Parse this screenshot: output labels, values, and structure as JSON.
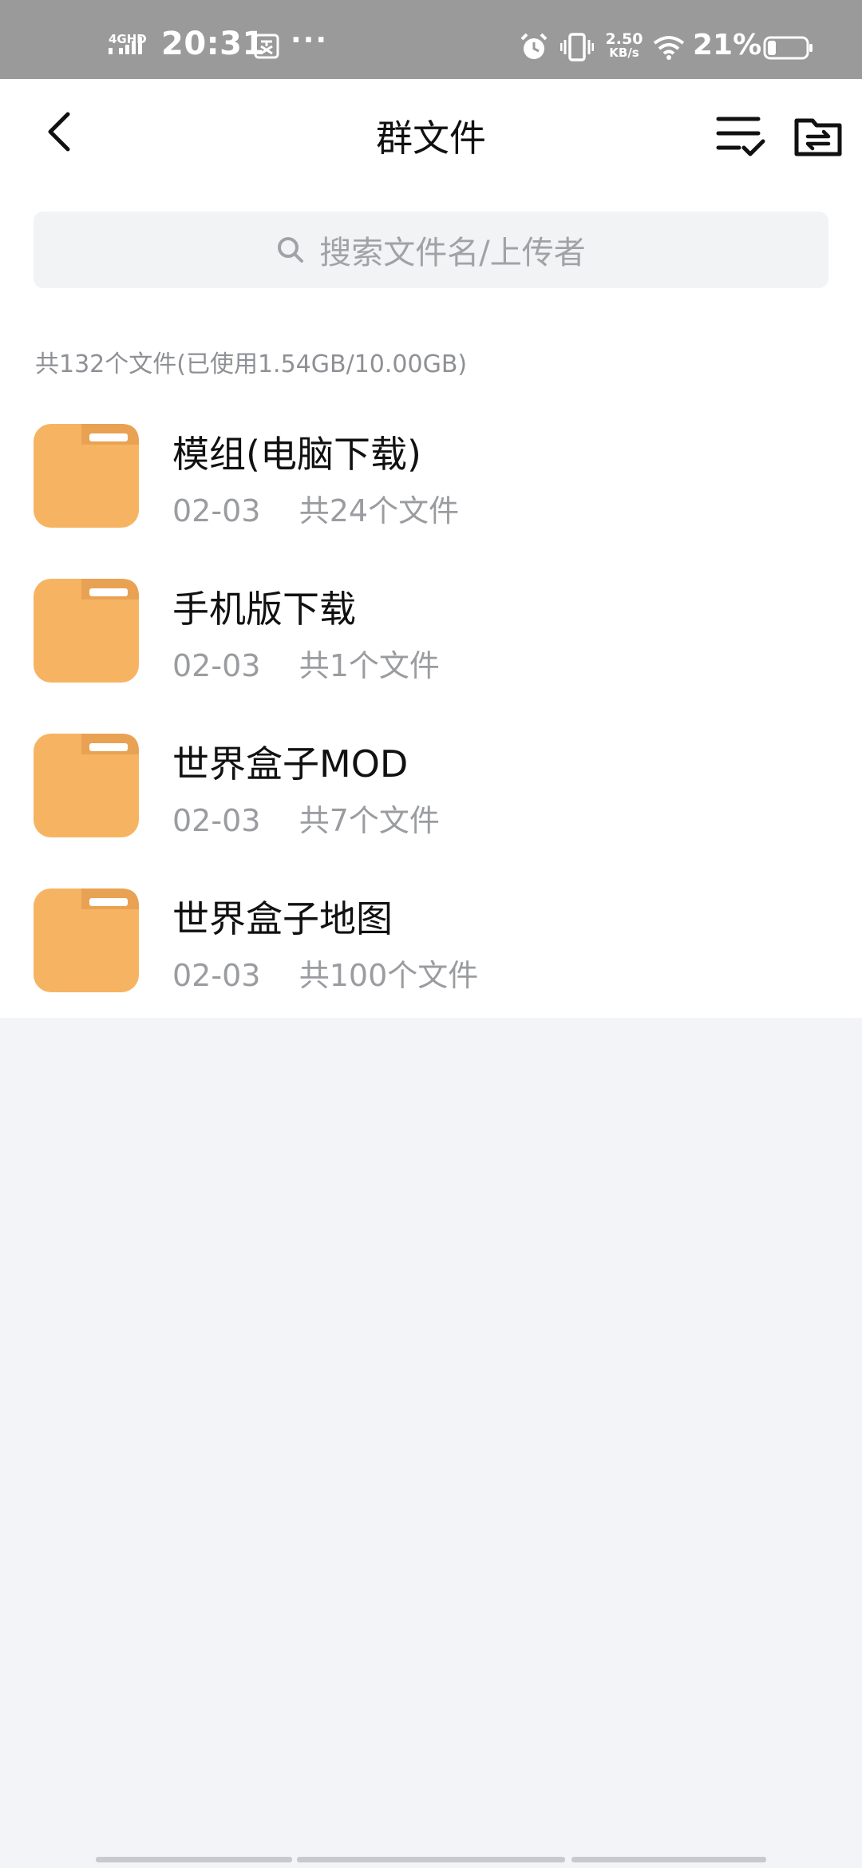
{
  "status_bar": {
    "network": "4GHD",
    "time": "20:31",
    "more": "···",
    "speed_value": "2.50",
    "speed_unit": "KB/s",
    "battery_percent": "21%"
  },
  "header": {
    "title": "群文件"
  },
  "search": {
    "placeholder": "搜索文件名/上传者"
  },
  "summary": "共132个文件(已使用1.54GB/10.00GB)",
  "files": [
    {
      "name": "模组(电脑下载)",
      "date": "02-03",
      "count": "共24个文件"
    },
    {
      "name": "手机版下载",
      "date": "02-03",
      "count": "共1个文件"
    },
    {
      "name": "世界盒子MOD",
      "date": "02-03",
      "count": "共7个文件"
    },
    {
      "name": "世界盒子地图",
      "date": "02-03",
      "count": "共100个文件"
    }
  ],
  "colors": {
    "folder": "#f6b462",
    "folder_tab": "#e9a253",
    "status_bar_bg": "#9a9a9a",
    "page_bg": "#f3f4f8"
  }
}
